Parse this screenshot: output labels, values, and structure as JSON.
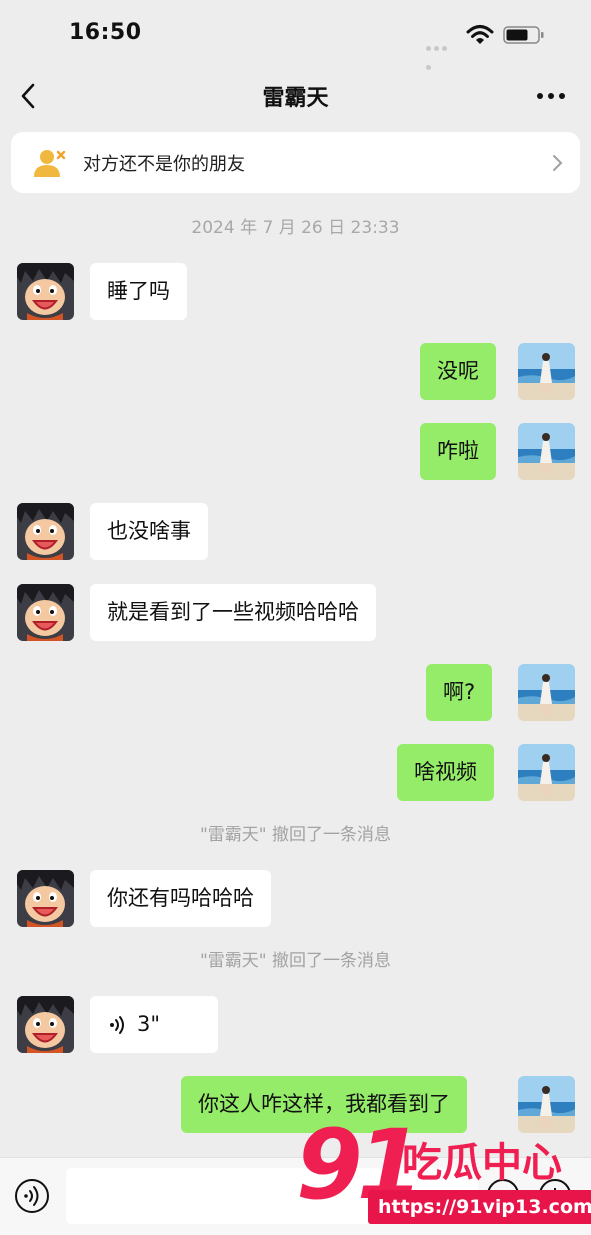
{
  "status_bar": {
    "time": "16:50"
  },
  "nav": {
    "title": "雷霸天"
  },
  "banner": {
    "text": "对方还不是你的朋友"
  },
  "timestamp": "2024 年 7 月 26 日 23:33",
  "messages": [
    {
      "side": "in",
      "text": "睡了吗"
    },
    {
      "side": "out",
      "text": "没呢"
    },
    {
      "side": "out",
      "text": "咋啦"
    },
    {
      "side": "in",
      "text": "也没啥事"
    },
    {
      "side": "in",
      "text": "就是看到了一些视频哈哈哈"
    },
    {
      "side": "out",
      "text": "啊?"
    },
    {
      "side": "out",
      "text": "啥视频"
    },
    {
      "side": "in",
      "text": "你还有吗哈哈哈"
    },
    {
      "side": "in",
      "type": "voice",
      "text": "3\""
    },
    {
      "side": "out",
      "text": "你这人咋这样，我都看到了"
    }
  ],
  "recall_notices": [
    "\"雷霸天\" 撤回了一条消息",
    "\"雷霸天\" 撤回了一条消息"
  ],
  "watermark": {
    "number": "91",
    "title": "吃瓜中心",
    "url": "https://91vip13.com"
  },
  "colors": {
    "background": "#ededed",
    "outgoing_bubble": "#95ec69",
    "incoming_bubble": "#ffffff",
    "watermark": "#f01f52"
  }
}
